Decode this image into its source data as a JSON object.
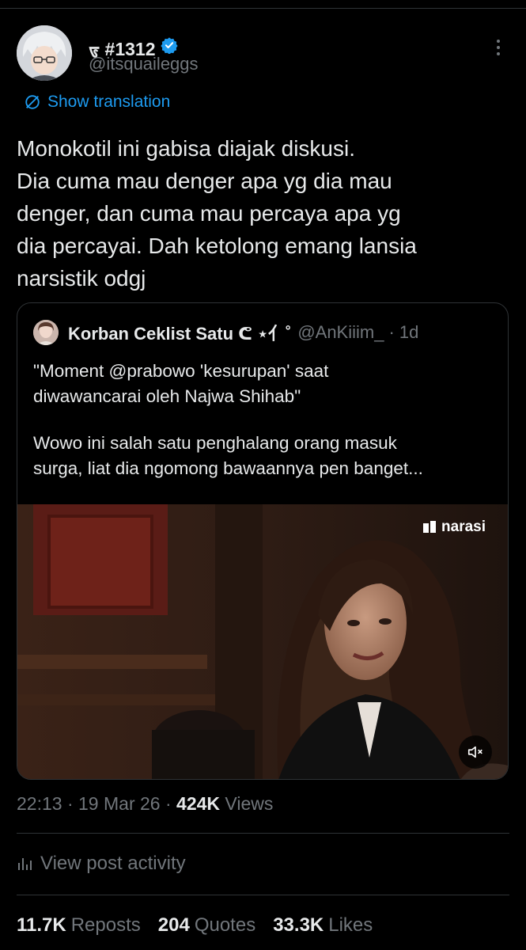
{
  "author": {
    "display_name": "ᢎ #1312",
    "handle": "@itsquaileggs",
    "verified_icon": "verified-badge-icon",
    "accent": "#1d9bf0"
  },
  "translation_label": "Show translation",
  "tweet_lines": [
    "Monokotil ini gabisa diajak diskusi.",
    "Dia cuma mau denger apa yg dia mau",
    "denger, dan cuma mau percaya apa yg",
    "dia percayai. Dah ketolong emang lansia",
    "narsistik odgj"
  ],
  "quote": {
    "name": "Korban Ceklist Satu ᕦ ⋆⺅˚",
    "handle": "@AnKiiim_",
    "time": "· 1d",
    "text_lines_1": [
      "\"Moment @prabowo 'kesurupan' saat",
      "diwawancarai oleh Najwa Shihab\""
    ],
    "text_lines_2": [
      "Wowo ini salah satu penghalang orang masuk",
      "surga, liat dia ngomong bawaannya pen banget..."
    ],
    "media_watermark": "narasi"
  },
  "meta": {
    "time": "22:13",
    "sep1": " · ",
    "date": "19 Mar 26",
    "sep2": " · ",
    "views_count": "424K",
    "views_label": " Views"
  },
  "activity_label": "View post activity",
  "stats": [
    {
      "count": "11.7K",
      "label": "Reposts"
    },
    {
      "count": "204",
      "label": "Quotes"
    },
    {
      "count": "33.3K",
      "label": "Likes"
    }
  ]
}
